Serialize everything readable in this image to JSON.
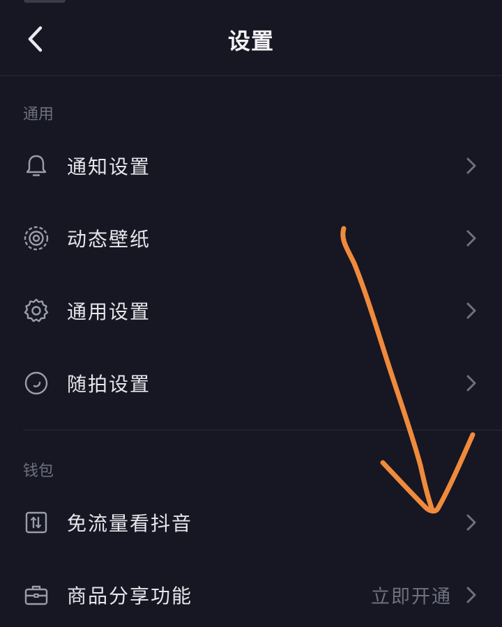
{
  "header": {
    "title": "设置",
    "back_icon": "back-arrow-icon"
  },
  "sections": [
    {
      "title": "通用",
      "items": [
        {
          "label": "通知设置",
          "icon": "bell-icon"
        },
        {
          "label": "动态壁纸",
          "icon": "live-wallpaper-icon"
        },
        {
          "label": "通用设置",
          "icon": "gear-icon"
        },
        {
          "label": "随拍设置",
          "icon": "quick-shot-icon"
        }
      ]
    },
    {
      "title": "钱包",
      "items": [
        {
          "label": "免流量看抖音",
          "icon": "data-free-icon"
        },
        {
          "label": "商品分享功能",
          "icon": "briefcase-icon",
          "value": "立即开通"
        }
      ]
    }
  ],
  "colors": {
    "background": "#161722",
    "annotation_arrow": "#f08a3c",
    "secondary_text": "#6f7080"
  }
}
